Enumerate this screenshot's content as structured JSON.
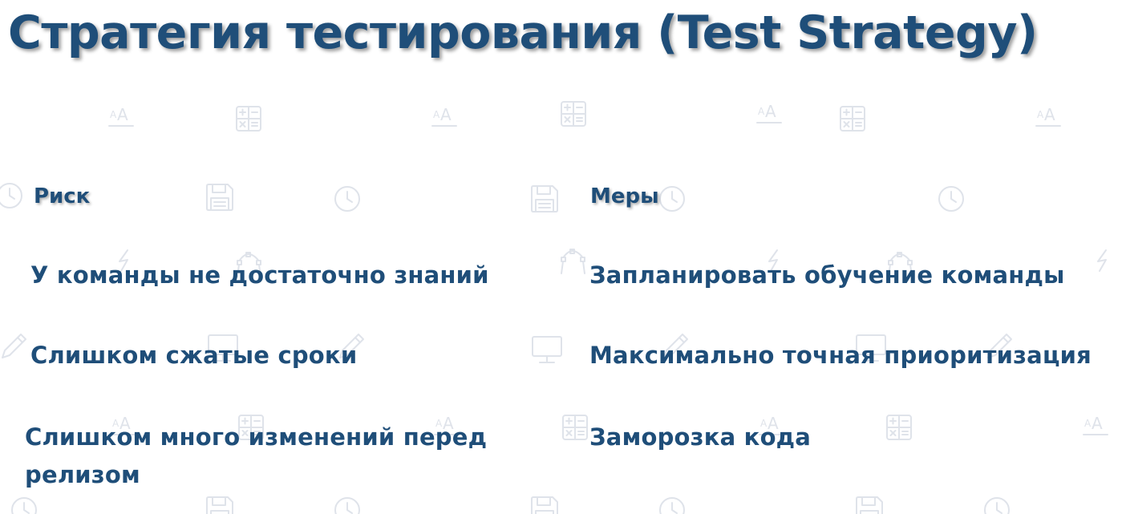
{
  "slide": {
    "title": "Стратегия тестирования (Test Strategy)"
  },
  "table": {
    "headers": {
      "risk": "Риск",
      "measures": "Меры"
    },
    "rows": [
      {
        "risk": "У команды не достаточно знаний",
        "measure": "Запланировать обучение команды"
      },
      {
        "risk": "Слишком сжатые сроки",
        "measure": "Максимально точная приоритизация"
      },
      {
        "risk_line1": "Слишком много изменений перед",
        "risk_line2": "релизом",
        "measure": "Заморозка кода"
      }
    ]
  },
  "theme": {
    "text_color": "#1f4e79",
    "pattern_color": "#dfe3ea",
    "background": "#ffffff"
  }
}
